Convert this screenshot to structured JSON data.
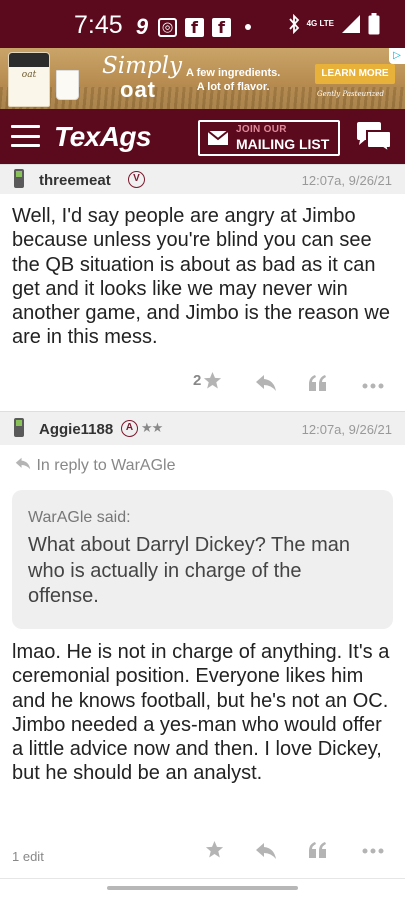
{
  "status_bar": {
    "time": "7:45",
    "network": "4G LTE"
  },
  "ad": {
    "brand_line1": "Simply",
    "brand_line2": "oat",
    "tagline_line1": "A few ingredients.",
    "tagline_line2": "A lot of flavor.",
    "cta": "LEARN MORE",
    "fine_print": "Gently Pasteurized",
    "carton_label": "oat"
  },
  "nav": {
    "logo": "TexAgs",
    "mailing_join": "JOIN OUR",
    "mailing_list": "MAILING LIST"
  },
  "posts": [
    {
      "author": "threemeat",
      "badge": "V",
      "stars": "",
      "timestamp": "12:07a, 9/26/21",
      "body": "Well, I'd say people are angry at Jimbo because unless you're blind you can see the QB situation is about as bad as it can get and it looks like we may never win another game, and Jimbo is the reason we are in this mess.",
      "star_count": "2"
    },
    {
      "author": "Aggie1188",
      "badge": "A",
      "stars": "★★",
      "timestamp": "12:07a, 9/26/21",
      "reply_to": "In reply to WarAGle",
      "quote_author": "WarAGle said:",
      "quote_text": "What about Darryl Dickey? The man who is actually in charge of the offense.",
      "body": "lmao. He is not in charge of anything. It's a ceremonial position. Everyone likes him and he knows football, but he's not an OC. Jimbo needed a yes-man who would offer a little advice now and then. I love Dickey, but he should be an analyst.",
      "edit_note": "1 edit"
    }
  ],
  "colors": {
    "maroon": "#5b0a1d",
    "icon_grey": "#b4b4b4"
  }
}
